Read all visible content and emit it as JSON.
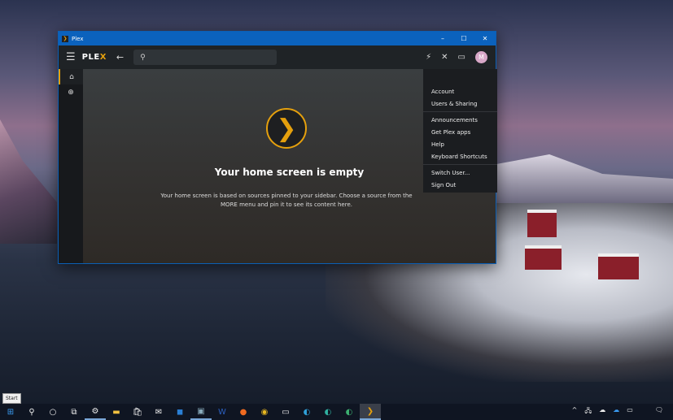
{
  "window": {
    "title": "Plex",
    "minimize": "–",
    "maximize": "☐",
    "close": "✕"
  },
  "toolbar": {
    "logo_main": "PLE",
    "logo_accent": "X",
    "avatar_initial": "M"
  },
  "main": {
    "title": "Your home screen is empty",
    "subtitle": "Your home screen is based on sources pinned to your sidebar. Choose a source from the MORE menu and pin it to see its content here."
  },
  "menu": {
    "group1": [
      "Account",
      "Users & Sharing"
    ],
    "group2": [
      "Announcements",
      "Get Plex apps",
      "Help",
      "Keyboard Shortcuts"
    ],
    "group3": [
      "Switch User...",
      "Sign Out"
    ]
  },
  "taskbar": {
    "tooltip": "Start"
  },
  "colors": {
    "accent": "#e5a00d",
    "titlebar": "#0b62bd"
  }
}
